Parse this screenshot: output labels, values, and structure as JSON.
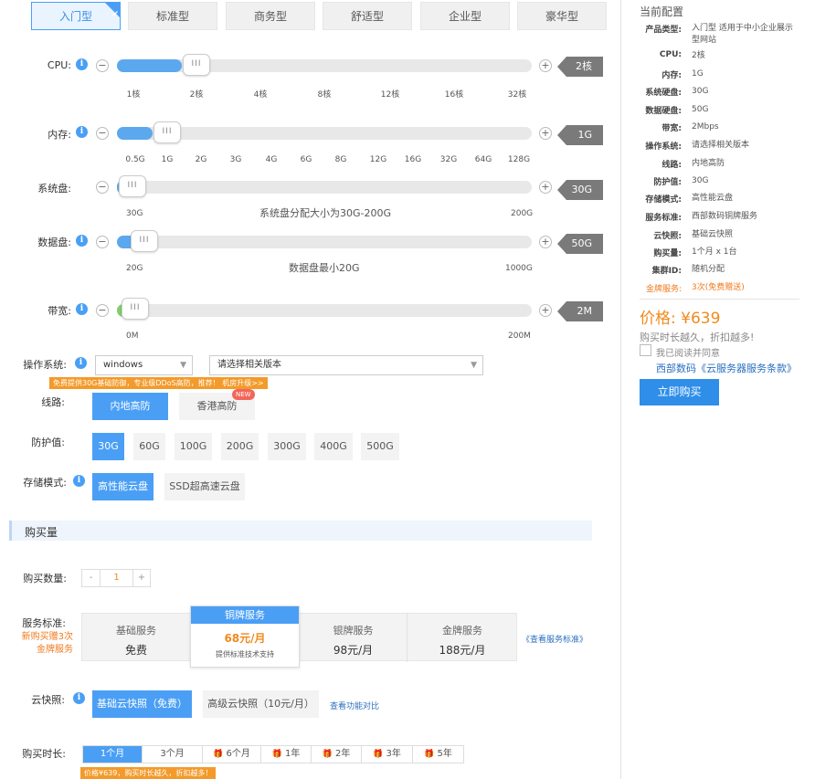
{
  "types": [
    "入门型",
    "标准型",
    "商务型",
    "舒适型",
    "企业型",
    "豪华型"
  ],
  "sliders": {
    "cpu": {
      "label": "CPU:",
      "value": "2核",
      "level": 0.13,
      "ticks": [
        "1核",
        "2核",
        "4核",
        "8核",
        "12核",
        "16核",
        "32核"
      ]
    },
    "memory": {
      "label": "内存:",
      "value": "1G",
      "level": 0.06,
      "ticks": [
        "0.5G",
        "1G",
        "2G",
        "3G",
        "4G",
        "6G",
        "8G",
        "12G",
        "16G",
        "32G",
        "64G",
        "128G"
      ]
    },
    "sysdisk": {
      "label": "系统盘:",
      "value": "30G",
      "level": 0.0,
      "min": "30G",
      "max": "200G",
      "hint": "系统盘分配大小为30G-200G"
    },
    "datadisk": {
      "label": "数据盘:",
      "value": "50G",
      "level": 0.03,
      "min": "20G",
      "max": "1000G",
      "hint": "数据盘最小20G"
    },
    "bandwidth": {
      "label": "带宽:",
      "value": "2M",
      "level": 0.01,
      "min": "0M",
      "max": "200M"
    }
  },
  "os": {
    "label": "操作系统:",
    "type_value": "windows",
    "version_placeholder": "请选择相关版本",
    "promo": "免费提供30G基础防御，专业级DDoS高防，推荐！ 机房升级>>"
  },
  "line": {
    "label": "线路:",
    "options": [
      "内地高防",
      "香港高防"
    ],
    "new_badge": "NEW"
  },
  "defense": {
    "label": "防护值:",
    "options": [
      "30G",
      "60G",
      "100G",
      "200G",
      "300G",
      "400G",
      "500G"
    ]
  },
  "storage": {
    "label": "存储模式:",
    "options": [
      "高性能云盘",
      "SSD超高速云盘"
    ]
  },
  "purchase": {
    "section_title": "购买量",
    "qty_label": "购买数量:",
    "qty_minus": "-",
    "qty_value": "1",
    "qty_plus": "+",
    "svc_label": "服务标准:",
    "svc_note": "新购买赠3次金牌服务",
    "services": [
      {
        "name": "基础服务",
        "price": "免费"
      },
      {
        "name": "铜牌服务",
        "price": "68元/月",
        "desc": "提供标准技术支持"
      },
      {
        "name": "银牌服务",
        "price": "98元/月"
      },
      {
        "name": "金牌服务",
        "price": "188元/月"
      }
    ],
    "svc_link": "《查看服务标准》",
    "snap_label": "云快照:",
    "snap_options": [
      "基础云快照（免费）",
      "高级云快照（10元/月）"
    ],
    "snap_link": "查看功能对比",
    "dur_label": "购买时长:",
    "durations": [
      "1个月",
      "3个月",
      "6个月",
      "1年",
      "2年",
      "3年",
      "5年"
    ],
    "dur_note": "价格¥639，购买时长越久，折扣越多！"
  },
  "config": {
    "title": "当前配置",
    "rows": [
      {
        "k": "产品类型:",
        "v": "入门型 适用于中小企业展示型网站"
      },
      {
        "k": "CPU:",
        "v": "2核"
      },
      {
        "k": "内存:",
        "v": "1G"
      },
      {
        "k": "系统硬盘:",
        "v": "30G"
      },
      {
        "k": "数据硬盘:",
        "v": "50G"
      },
      {
        "k": "带宽:",
        "v": "2Mbps"
      },
      {
        "k": "操作系统:",
        "v": "请选择相关版本"
      },
      {
        "k": "线路:",
        "v": "内地高防"
      },
      {
        "k": "防护值:",
        "v": "30G"
      },
      {
        "k": "存储模式:",
        "v": "高性能云盘"
      },
      {
        "k": "服务标准:",
        "v": "西部数码铜牌服务"
      },
      {
        "k": "云快照:",
        "v": "基础云快照"
      },
      {
        "k": "购买量:",
        "v": "1个月 x 1台"
      },
      {
        "k": "集群ID:",
        "v": "随机分配"
      },
      {
        "k": "金牌服务:",
        "v": "3次(免费赠送)"
      }
    ],
    "price": "价格: ¥639",
    "price_sub": "购买时长越久，折扣越多!",
    "agree": "我已阅读并同意",
    "terms": "西部数码《云服务器服务条款》",
    "buy": "立即购买"
  },
  "colors": {
    "accent": "#4a9ff5",
    "orange": "#f08a1e",
    "badge": "#7a7a7a"
  }
}
